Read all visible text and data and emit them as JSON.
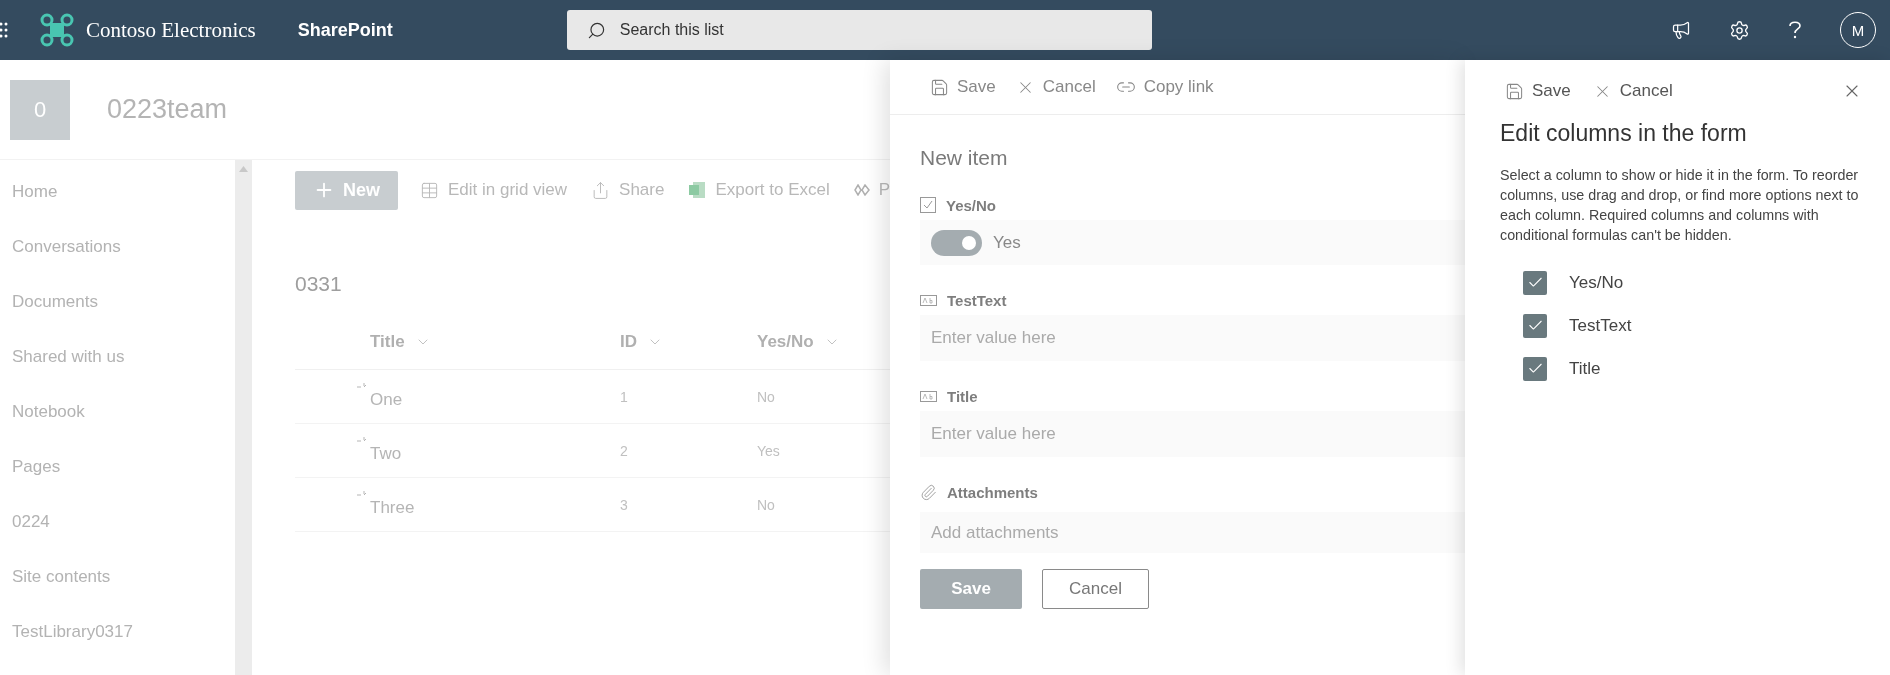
{
  "top_bar": {
    "brand": "Contoso Electronics",
    "app_name": "SharePoint",
    "search": {
      "placeholder": "Search this list"
    },
    "avatar": "M"
  },
  "site": {
    "logo_letter": "0",
    "title": "0223team"
  },
  "nav": {
    "items": [
      {
        "label": "Home"
      },
      {
        "label": "Conversations"
      },
      {
        "label": "Documents"
      },
      {
        "label": "Shared with us"
      },
      {
        "label": "Notebook"
      },
      {
        "label": "Pages"
      },
      {
        "label": "0224"
      },
      {
        "label": "Site contents"
      },
      {
        "label": "TestLibrary0317"
      }
    ]
  },
  "command_bar": {
    "items": [
      {
        "kind": "new",
        "label": "New"
      },
      {
        "kind": "grid",
        "label": "Edit in grid view"
      },
      {
        "kind": "share",
        "label": "Share"
      },
      {
        "kind": "excel",
        "label": "Export to Excel"
      },
      {
        "kind": "flow",
        "label": "P"
      }
    ]
  },
  "list": {
    "title": "0331",
    "columns": [
      "Title",
      "ID",
      "Yes/No"
    ],
    "rows": [
      {
        "cells": [
          "One",
          "1",
          "No"
        ]
      },
      {
        "cells": [
          "Two",
          "2",
          "Yes"
        ]
      },
      {
        "cells": [
          "Three",
          "3",
          "No"
        ]
      }
    ]
  },
  "form_panel": {
    "toolbar": [
      {
        "kind": "save",
        "label": "Save"
      },
      {
        "kind": "cancel",
        "label": "Cancel"
      },
      {
        "kind": "link",
        "label": "Copy link"
      }
    ],
    "title": "New item",
    "fields": [
      {
        "kind": "toggle",
        "label": "Yes/No",
        "on": true,
        "value": "Yes"
      },
      {
        "kind": "text",
        "label": "TestText",
        "placeholder": "Enter value here"
      },
      {
        "kind": "text",
        "label": "Title",
        "placeholder": "Enter value here"
      },
      {
        "kind": "attachments",
        "label": "Attachments",
        "placeholder": "Add attachments"
      }
    ],
    "buttons": [
      {
        "kind": "primary",
        "label": "Save"
      },
      {
        "kind": "default",
        "label": "Cancel"
      }
    ]
  },
  "columns_panel": {
    "toolbar": [
      {
        "kind": "save",
        "label": "Save"
      },
      {
        "kind": "cancel",
        "label": "Cancel"
      }
    ],
    "title": "Edit columns in the form",
    "description": "Select a column to show or hide it in the form. To reorder columns, use drag and drop, or find more options next to each column. Required columns and columns with conditional formulas can't be hidden.",
    "columns": [
      {
        "label": "Yes/No",
        "checked": true
      },
      {
        "label": "TestText",
        "checked": true
      },
      {
        "label": "Title",
        "checked": true
      }
    ]
  }
}
